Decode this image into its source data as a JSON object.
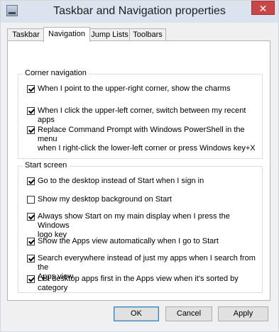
{
  "window": {
    "title": "Taskbar and Navigation properties",
    "close_label": "✕"
  },
  "tabs": [
    {
      "label": "Taskbar",
      "active": false
    },
    {
      "label": "Navigation",
      "active": true
    },
    {
      "label": "Jump Lists",
      "active": false
    },
    {
      "label": "Toolbars",
      "active": false
    }
  ],
  "corner_navigation": {
    "heading": "Corner navigation",
    "options": [
      {
        "line1": "When I point to the upper-right corner, show the charms",
        "line2": "",
        "checked": true
      },
      {
        "line1": "When I click the upper-left corner, switch between my recent apps",
        "line2": "",
        "checked": true
      },
      {
        "line1": "Replace Command Prompt with Windows PowerShell in the menu",
        "line2": "when I right-click the lower-left corner or press Windows key+X",
        "checked": true
      }
    ]
  },
  "start_screen": {
    "heading": "Start screen",
    "options": [
      {
        "line1": "Go to the desktop instead of Start when I sign in",
        "line2": "",
        "checked": true
      },
      {
        "line1": "Show my desktop background on Start",
        "line2": "",
        "checked": false
      },
      {
        "line1": "Always show Start on my main display when I press the Windows",
        "line2": "logo key",
        "checked": true
      },
      {
        "line1": "Show the Apps view automatically when I go to Start",
        "line2": "",
        "checked": true
      },
      {
        "line1": "Search everywhere instead of just my apps when I search from the",
        "line2": "Apps view",
        "checked": true
      },
      {
        "line1": "List desktop apps first in the Apps view when it's sorted by",
        "line2": "category",
        "checked": true
      }
    ]
  },
  "buttons": {
    "ok": "OK",
    "cancel": "Cancel",
    "apply": "Apply"
  }
}
